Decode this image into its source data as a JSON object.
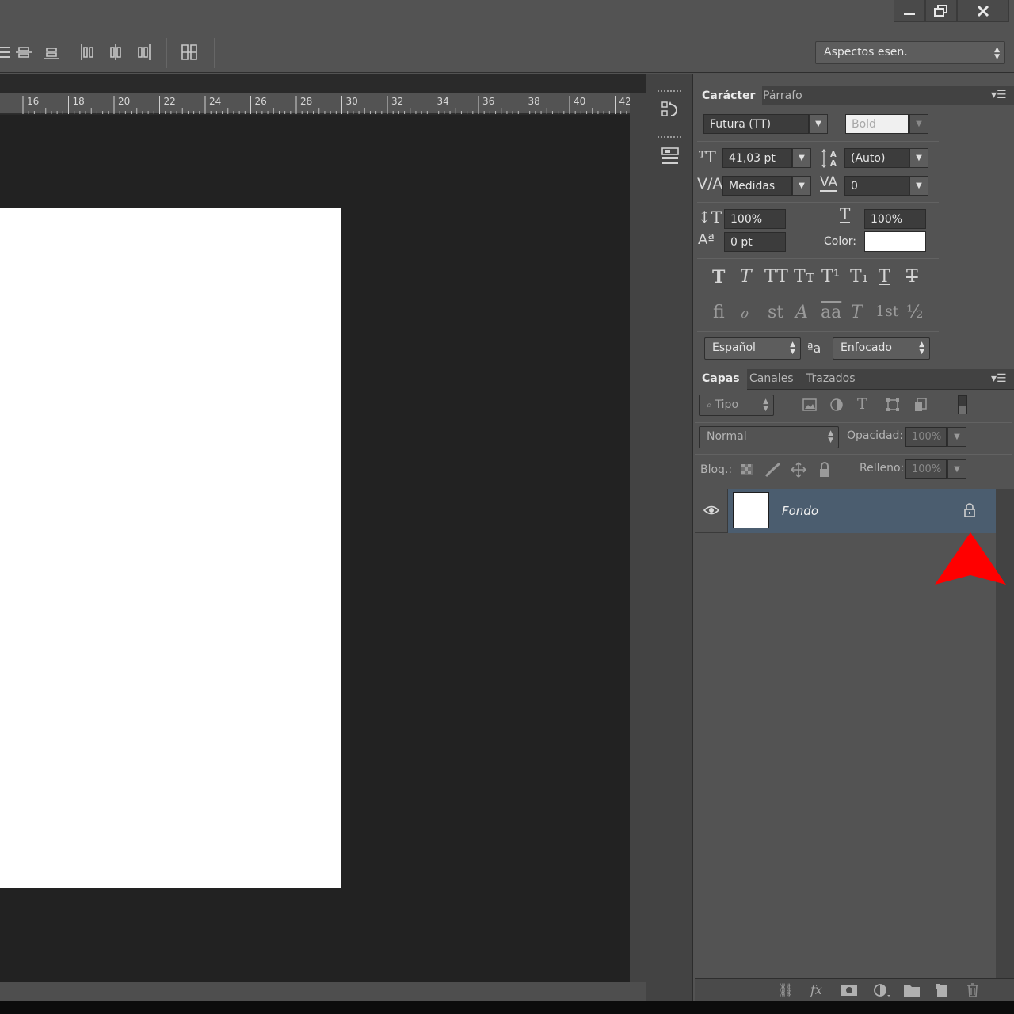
{
  "window": {
    "minimize_icon": "minimize-icon",
    "restore_icon": "restore-icon",
    "close_icon": "close-icon"
  },
  "options_bar": {
    "workspace": "Aspectos esen."
  },
  "ruler": {
    "labels": [
      "16",
      "18",
      "20",
      "22",
      "24",
      "26",
      "28",
      "30",
      "32",
      "34",
      "36",
      "38",
      "40",
      "42"
    ]
  },
  "character_panel": {
    "tabs": [
      "Carácter",
      "Párrafo"
    ],
    "font_family": "Futura (TT)",
    "font_style": "Bold",
    "font_size": "41,03 pt",
    "leading": "(Auto)",
    "kerning": "Medidas",
    "tracking": "0",
    "vertical_scale": "100%",
    "horizontal_scale": "100%",
    "baseline_shift": "0 pt",
    "color_label": "Color:",
    "color_value": "#ffffff",
    "style_buttons": [
      "T",
      "T",
      "TT",
      "Tт",
      "T¹",
      "T₁",
      "T",
      "T"
    ],
    "opentype_buttons": [
      "ﬁ",
      "ℴ",
      "st",
      "A",
      "aa",
      "T",
      "1st",
      "½"
    ],
    "language": "Español",
    "antialias": "Enfocado"
  },
  "layers_panel": {
    "tabs": [
      "Capas",
      "Canales",
      "Trazados"
    ],
    "filter": "Tipo",
    "blend_mode": "Normal",
    "opacity_label": "Opacidad:",
    "opacity_value": "100%",
    "lock_label": "Bloq.:",
    "fill_label": "Relleno:",
    "fill_value": "100%",
    "layers": [
      {
        "name": "Fondo",
        "visible": true,
        "locked": true,
        "selected": true
      }
    ]
  },
  "annotation": {
    "arrow_color": "#ff0000"
  }
}
